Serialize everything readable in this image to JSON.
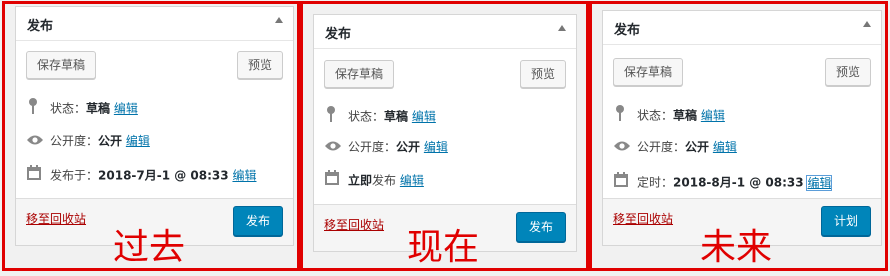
{
  "panels": [
    {
      "header": "发布",
      "save_draft": "保存草稿",
      "preview": "预览",
      "status_label": "状态：",
      "status_value": "草稿",
      "status_edit": "编辑",
      "visibility_label": "公开度：",
      "visibility_value": "公开",
      "visibility_edit": "编辑",
      "date_label": "发布于：",
      "date_value": "2018-7月-1 @ 08:33",
      "date_edit": "编辑",
      "trash": "移至回收站",
      "action": "发布",
      "caption": "过去"
    },
    {
      "header": "发布",
      "save_draft": "保存草稿",
      "preview": "预览",
      "status_label": "状态：",
      "status_value": "草稿",
      "status_edit": "编辑",
      "visibility_label": "公开度：",
      "visibility_value": "公开",
      "visibility_edit": "编辑",
      "date_label": "",
      "date_value": "立即",
      "date_suffix": "发布",
      "date_edit": "编辑",
      "trash": "移至回收站",
      "action": "发布",
      "caption": "现在"
    },
    {
      "header": "发布",
      "save_draft": "保存草稿",
      "preview": "预览",
      "status_label": "状态：",
      "status_value": "草稿",
      "status_edit": "编辑",
      "visibility_label": "公开度：",
      "visibility_value": "公开",
      "visibility_edit": "编辑",
      "date_label": "定时：",
      "date_value": "2018-8月-1 @ 08:33",
      "date_edit": "编辑",
      "trash": "移至回收站",
      "action": "计划",
      "caption": "未来"
    }
  ],
  "icons": {
    "status": "pin-icon",
    "visibility": "eye-icon",
    "date": "calendar-icon",
    "collapse": "triangle-up-icon"
  },
  "colors": {
    "frame": "#e00000",
    "link": "#0073aa",
    "trash": "#aa0000",
    "primary": "#0085ba"
  }
}
